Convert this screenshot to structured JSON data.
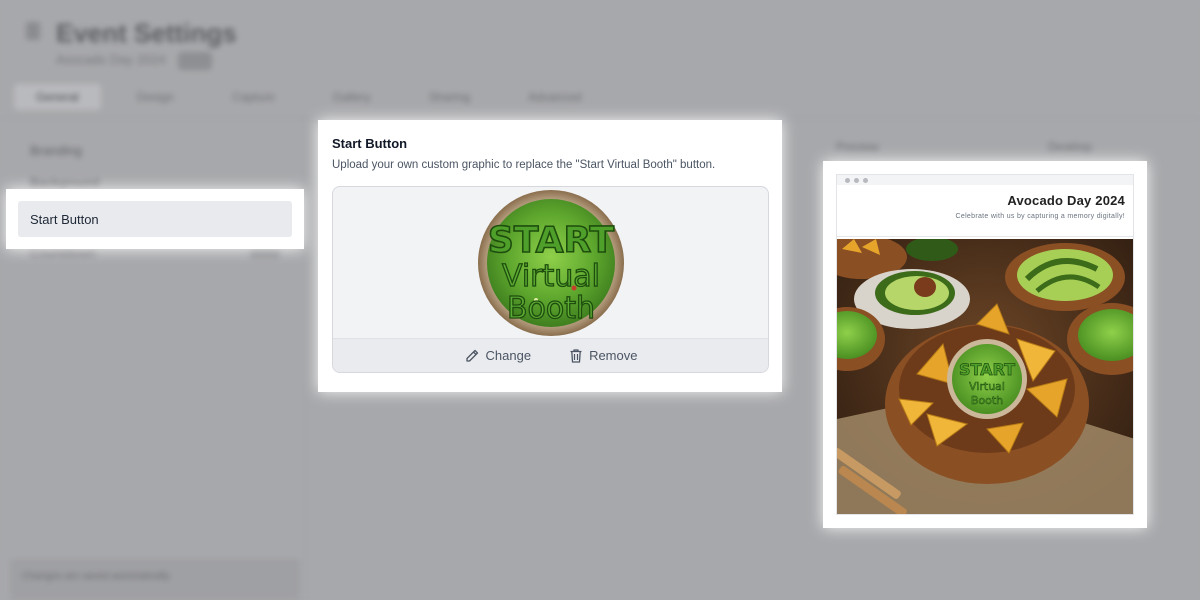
{
  "background": {
    "page_title": "Event Settings",
    "subtitle": "Avocado Day 2024",
    "tabs": [
      "General",
      "Design",
      "Capture",
      "Gallery",
      "Sharing",
      "Advanced"
    ],
    "sidebar_items": [
      "Branding",
      "Background",
      "Start Button",
      "Countdown"
    ],
    "footer_text": "Changes are saved automatically",
    "right_label_1": "Preview",
    "right_label_2": "Desktop"
  },
  "sidebar": {
    "active_item_label": "Start Button"
  },
  "start_button_card": {
    "title": "Start Button",
    "description": "Upload your own custom graphic to replace the \"Start Virtual Booth\" button.",
    "graphic_text": {
      "line1": "START",
      "line2": "Virtual",
      "line3": "Booth"
    },
    "change_label": "Change",
    "remove_label": "Remove"
  },
  "preview": {
    "event_title": "Avocado Day 2024",
    "event_subtitle": "Celebrate with us by capturing a memory digitally!"
  },
  "colors": {
    "overlay": "#a7a8ab",
    "guac_green": "#5fa82e",
    "start_text_green": "#3f8f1e",
    "bowl_brown": "#8b5a2b",
    "chip_yellow": "#e6a52a"
  }
}
